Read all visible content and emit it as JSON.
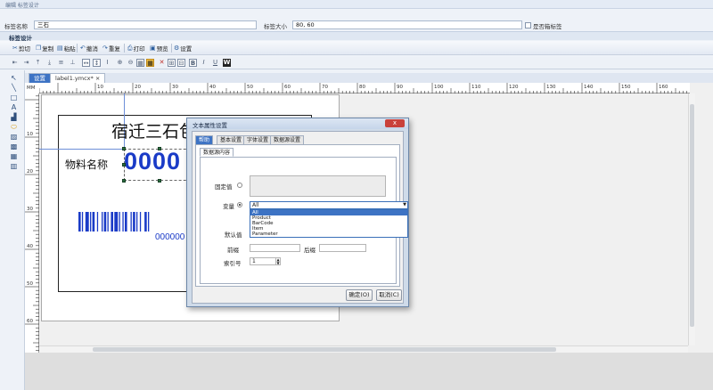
{
  "window": {
    "title": "编辑 标签设计"
  },
  "fields": {
    "name_label": "标签名称",
    "name_value": "三石",
    "size_label": "标签大小",
    "size_value": "80, 60",
    "pack_label": "是否箱标签"
  },
  "panel": {
    "title": "标签设计"
  },
  "toolbar": {
    "cut": "剪切",
    "copy": "复制",
    "paste": "粘贴",
    "undo": "撤消",
    "redo": "重复",
    "print": "打印",
    "preview": "预览",
    "settings": "设置"
  },
  "tabs": [
    {
      "label": "设置"
    },
    {
      "label": "label1.ymcx*"
    }
  ],
  "ruler": {
    "unit": "MM",
    "top_ticks": [
      "10",
      "20",
      "30",
      "40",
      "50",
      "60",
      "70",
      "80",
      "90",
      "100",
      "110",
      "120",
      "130",
      "140",
      "150",
      "160",
      "170"
    ],
    "left_ticks": [
      "10",
      "20",
      "30",
      "40",
      "50",
      "60"
    ]
  },
  "label": {
    "title": "宿迁三石包",
    "field_name": "物料名称",
    "number": "0000",
    "barcode_text": "000000"
  },
  "dialog": {
    "title": "文本属性设置",
    "close": "x",
    "tabs": [
      "帮助",
      "基本设置",
      "字体设置",
      "数据源设置"
    ],
    "subtab": "数据源内容",
    "fixed_label": "固定值",
    "variable_label": "变量",
    "variable_value": "All",
    "options": [
      "All",
      "Product",
      "BarCode",
      "Item",
      "Parameter"
    ],
    "default_label": "默认值",
    "prefix_label": "前缀",
    "suffix_label": "后缀",
    "index_label": "索引号",
    "index_value": "1",
    "ok": "确定(O)",
    "cancel": "取消(C)"
  }
}
